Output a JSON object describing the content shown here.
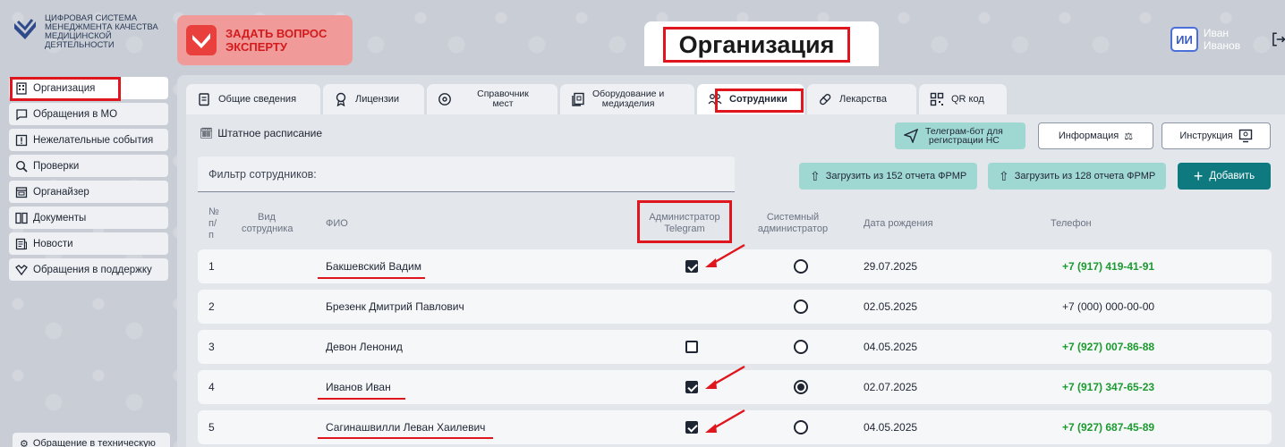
{
  "logo": {
    "lines": [
      "ЦИФРОВАЯ СИСТЕМА",
      "МЕНЕДЖМЕНТА КАЧЕСТВА",
      "МЕДИЦИНСКОЙ",
      "ДЕЯТЕЛЬНОСТИ"
    ]
  },
  "header": {
    "ask_expert_line1": "ЗАДАТЬ ВОПРОС",
    "ask_expert_line2": "ЭКСПЕРТУ",
    "page_title": "Организация",
    "user_initials": "ИИ",
    "user_name": "Иван Иванов"
  },
  "sidebar": {
    "items": [
      {
        "label": "Организация",
        "icon": "building-icon"
      },
      {
        "label": "Обращения в МО",
        "icon": "chat-icon"
      },
      {
        "label": "Нежелательные события",
        "icon": "alert-icon"
      },
      {
        "label": "Проверки",
        "icon": "search-icon"
      },
      {
        "label": "Органайзер",
        "icon": "calendar-icon"
      },
      {
        "label": "Документы",
        "icon": "documents-icon"
      },
      {
        "label": "Новости",
        "icon": "news-icon"
      },
      {
        "label": "Обращения в поддержку",
        "icon": "support-icon"
      }
    ],
    "bottom_label": "Обращение в техническую"
  },
  "tabs": [
    {
      "label": "Общие сведения",
      "icon": "clipboard-icon"
    },
    {
      "label": "Лицензии",
      "icon": "award-icon"
    },
    {
      "label_line1": "Справочник",
      "label_line2": "мест",
      "icon": "location-icon"
    },
    {
      "label_line1": "Оборудование и",
      "label_line2": "медизделия",
      "icon": "equipment-icon"
    },
    {
      "label": "Сотрудники",
      "icon": "people-icon"
    },
    {
      "label": "Лекарства",
      "icon": "pill-icon"
    },
    {
      "label": "QR код",
      "icon": "qr-icon"
    }
  ],
  "toolbar": {
    "section_title": "Штатное расписание",
    "tg_bot_line1": "Телеграм-бот для",
    "tg_bot_line2": "регистрации НС",
    "info_label": "Информация",
    "instruction_label": "Инструкция",
    "filter_placeholder": "Фильтр сотрудников:",
    "upload_152": "Загрузить из 152 отчета ФРМР",
    "upload_128": "Загрузить из 128 отчета ФРМР",
    "add_label": "Добавить"
  },
  "table": {
    "headers": {
      "num_line1": "№",
      "num_line2": "п/",
      "num_line3": "п",
      "type_line1": "Вид",
      "type_line2": "сотрудника",
      "fio": "ФИО",
      "tg_admin_line1": "Администратор",
      "tg_admin_line2": "Telegram",
      "sys_admin_line1": "Системный",
      "sys_admin_line2": "администратор",
      "birth": "Дата рождения",
      "phone": "Телефон"
    },
    "rows": [
      {
        "num": "1",
        "fio": "Бакшевский Вадим",
        "tg_admin": "checked",
        "sys_admin": false,
        "birth": "29.07.2025",
        "phone": "+7 (917) 419-41-91",
        "phone_green": true
      },
      {
        "num": "2",
        "fio": "Брезенк Дмитрий Павлович",
        "tg_admin": "none",
        "sys_admin": false,
        "birth": "02.05.2025",
        "phone": "+7 (000) 000-00-00",
        "phone_green": false
      },
      {
        "num": "3",
        "fio": "Девон Ленонид",
        "tg_admin": "unchecked",
        "sys_admin": false,
        "birth": "04.05.2025",
        "phone": "+7 (927) 007-86-88",
        "phone_green": true
      },
      {
        "num": "4",
        "fio": "Иванов Иван",
        "tg_admin": "checked",
        "sys_admin": true,
        "birth": "02.07.2025",
        "phone": "+7 (917) 347-65-23",
        "phone_green": true
      },
      {
        "num": "5",
        "fio": "Сагинашвилли Леван Хаилевич",
        "tg_admin": "checked",
        "sys_admin": false,
        "birth": "04.05.2025",
        "phone": "+7 (927) 687-45-89",
        "phone_green": true
      }
    ]
  },
  "colors": {
    "accent_red": "#e0161e",
    "teal": "#0e7a80",
    "teal_light": "#9fd8d3",
    "phone_green": "#1b9a2f"
  }
}
